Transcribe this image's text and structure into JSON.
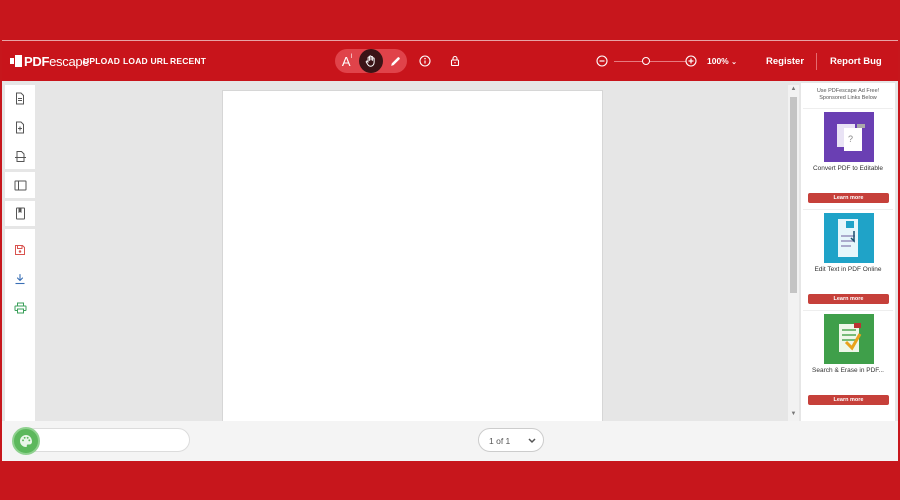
{
  "header": {
    "logo_text_bold": "PDF",
    "logo_text_light": "escape",
    "nav": [
      "UPLOAD",
      "LOAD URL",
      "RECENT"
    ],
    "zoom_value": "100%",
    "zoom_level": 0.45,
    "register_label": "Register",
    "report_bug_label": "Report Bug"
  },
  "tools": {
    "text_tool_label": "A",
    "active_tool": "hand"
  },
  "ads": {
    "header_line1": "Use PDFescape Ad Free!",
    "header_line2": "Sponsored Links Below",
    "cards": [
      {
        "title": "Convert PDF to Editable",
        "button": "Learn more",
        "color": "#6a3fb3"
      },
      {
        "title": "Edit Text in PDF Online",
        "button": "Learn more",
        "color": "#1fa3c8"
      },
      {
        "title": "Search & Erase in PDF...",
        "button": "Learn more",
        "color": "#3f9f4a"
      }
    ]
  },
  "footer": {
    "page_indicator": "1 of 1"
  },
  "colors": {
    "brand_red": "#c8141b",
    "button_red": "#c6403a",
    "palette_green": "#5cb85c"
  }
}
